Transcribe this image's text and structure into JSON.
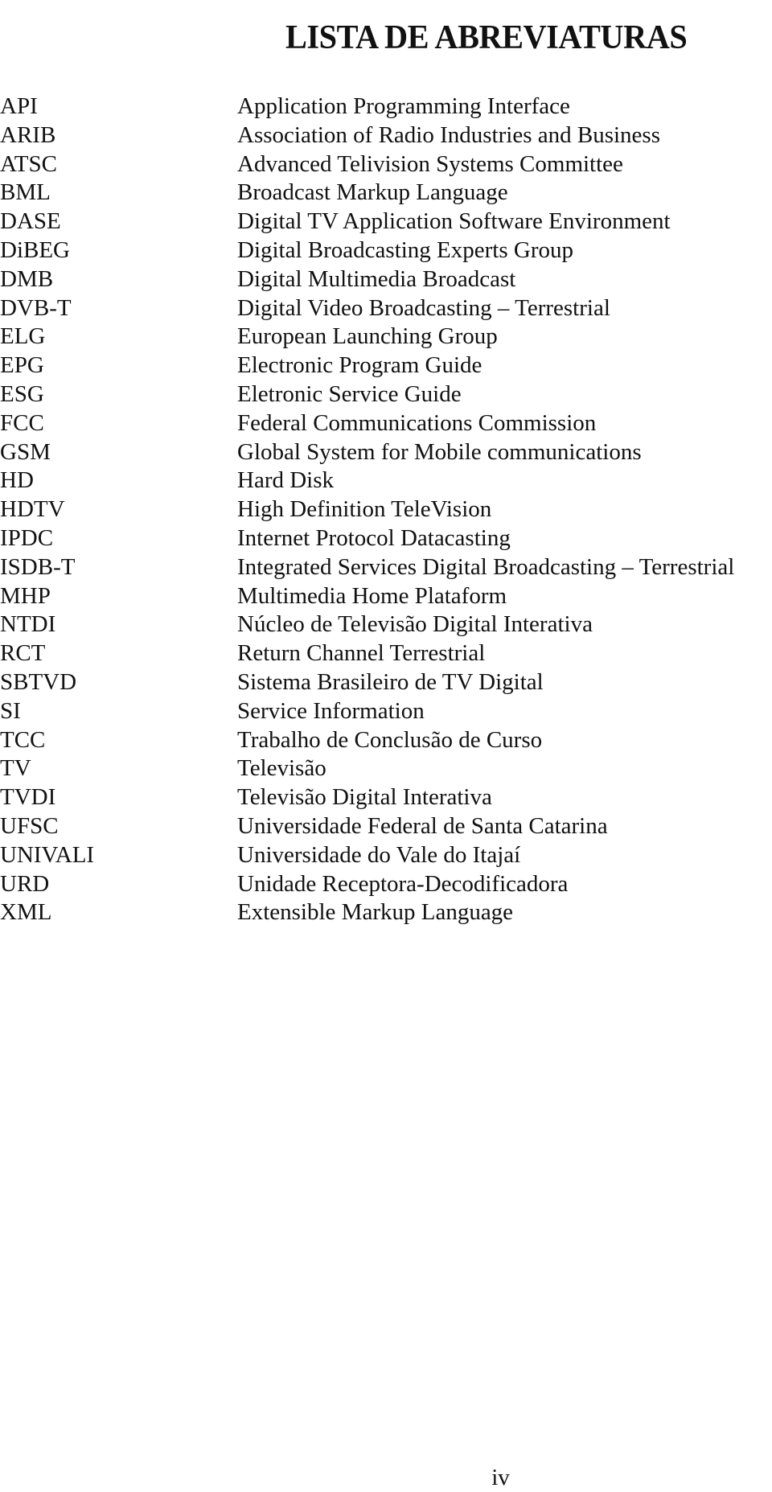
{
  "page": {
    "title": "LISTA DE ABREVIATURAS",
    "page_number": "iv"
  },
  "abbreviations": [
    {
      "abbr": "API",
      "definition": "Application Programming Interface"
    },
    {
      "abbr": "ARIB",
      "definition": "Association of Radio Industries and Business"
    },
    {
      "abbr": "ATSC",
      "definition": "Advanced Telivision Systems Committee"
    },
    {
      "abbr": "BML",
      "definition": "Broadcast Markup Language"
    },
    {
      "abbr": "DASE",
      "definition": "Digital TV Application Software Environment"
    },
    {
      "abbr": "DiBEG",
      "definition": "Digital Broadcasting Experts Group"
    },
    {
      "abbr": "DMB",
      "definition": "Digital Multimedia Broadcast"
    },
    {
      "abbr": "DVB-T",
      "definition": "Digital Video Broadcasting – Terrestrial"
    },
    {
      "abbr": "ELG",
      "definition": "European Launching Group"
    },
    {
      "abbr": "EPG",
      "definition": "Electronic Program Guide"
    },
    {
      "abbr": "ESG",
      "definition": "Eletronic Service Guide"
    },
    {
      "abbr": "FCC",
      "definition": "Federal Communications Commission"
    },
    {
      "abbr": "GSM",
      "definition": "Global System for Mobile communications"
    },
    {
      "abbr": "HD",
      "definition": "Hard Disk"
    },
    {
      "abbr": "HDTV",
      "definition": "High Definition TeleVision"
    },
    {
      "abbr": "IPDC",
      "definition": "Internet Protocol Datacasting"
    },
    {
      "abbr": "ISDB-T",
      "definition": "Integrated Services Digital Broadcasting – Terrestrial"
    },
    {
      "abbr": "MHP",
      "definition": "Multimedia Home Plataform"
    },
    {
      "abbr": "NTDI",
      "definition": "Núcleo de Televisão Digital Interativa"
    },
    {
      "abbr": "RCT",
      "definition": "Return Channel Terrestrial"
    },
    {
      "abbr": "SBTVD",
      "definition": "Sistema Brasileiro de TV Digital"
    },
    {
      "abbr": "SI",
      "definition": "Service Information"
    },
    {
      "abbr": "TCC",
      "definition": "Trabalho de Conclusão de Curso"
    },
    {
      "abbr": "TV",
      "definition": "Televisão"
    },
    {
      "abbr": "TVDI",
      "definition": "Televisão Digital Interativa"
    },
    {
      "abbr": "UFSC",
      "definition": "Universidade Federal de Santa Catarina"
    },
    {
      "abbr": "UNIVALI",
      "definition": "Universidade do Vale do Itajaí"
    },
    {
      "abbr": "URD",
      "definition": "Unidade Receptora-Decodificadora"
    },
    {
      "abbr": "XML",
      "definition": "Extensible Markup Language"
    }
  ]
}
